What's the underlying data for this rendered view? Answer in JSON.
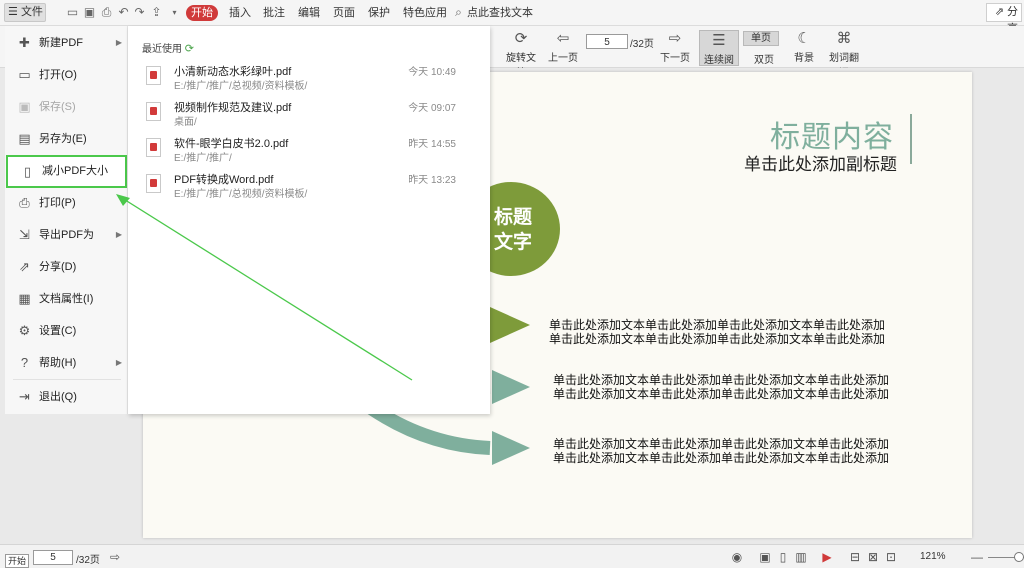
{
  "titlebar": {
    "menu_label": "文件",
    "tabs": [
      "开始",
      "插入",
      "批注",
      "编辑",
      "页面",
      "保护",
      "特色应用"
    ],
    "search_label": "点此查找文本",
    "share_label": "分享"
  },
  "ribbon": {
    "rotate_label": "旋转文档",
    "prev_label": "上一页",
    "next_label": "下一页",
    "page_value": "5",
    "page_total": "/32页",
    "continuous_label": "连续阅读",
    "single_label": "单页",
    "double_label": "双页",
    "bg_label": "背景",
    "translate_label": "划词翻译"
  },
  "file_menu": {
    "items": [
      {
        "label": "新建PDF",
        "icon": "new-pdf-icon"
      },
      {
        "label": "打开(O)",
        "icon": "folder-open-icon"
      },
      {
        "label": "保存(S)",
        "icon": "save-icon"
      },
      {
        "label": "另存为(E)",
        "icon": "save-as-icon"
      },
      {
        "label": "减小PDF大小",
        "icon": "compress-icon"
      },
      {
        "label": "打印(P)",
        "icon": "print-icon"
      },
      {
        "label": "导出PDF为",
        "icon": "export-icon"
      },
      {
        "label": "分享(D)",
        "icon": "share-icon"
      },
      {
        "label": "文档属性(I)",
        "icon": "properties-icon"
      },
      {
        "label": "设置(C)",
        "icon": "settings-icon"
      },
      {
        "label": "帮助(H)",
        "icon": "help-icon"
      },
      {
        "label": "退出(Q)",
        "icon": "exit-icon"
      }
    ]
  },
  "recent": {
    "header": "最近使用",
    "files": [
      {
        "name": "小清新动态水彩绿叶.pdf",
        "path": "E:/推广/推广/总视频/资料模板/",
        "time": "今天 10:49"
      },
      {
        "name": "视频制作规范及建议.pdf",
        "path": "桌面/",
        "time": "今天 09:07"
      },
      {
        "name": "软件-眼学白皮书2.0.pdf",
        "path": "E:/推广/推广/",
        "time": "昨天 14:55"
      },
      {
        "name": "PDF转换成Word.pdf",
        "path": "E:/推广/推广/总视频/资料模板/",
        "time": "昨天 13:23"
      }
    ]
  },
  "document": {
    "title": "标题内容",
    "subtitle": "单击此处添加副标题",
    "circle_text": "标题文字",
    "lines": [
      "单击此处添加文本单击此处添加单击此处添加文本单击此处添加",
      "单击此处添加文本单击此处添加单击此处添加文本单击此处添加"
    ]
  },
  "statusbar": {
    "start_label": "开始",
    "page_value": "5",
    "page_total": "/32页",
    "zoom": "121%"
  },
  "colors": {
    "accent_red": "#d03a3a",
    "highlight_green": "#4bc84b",
    "circle_green": "#7e9b3a",
    "arrow_teal": "#7faf9d"
  }
}
